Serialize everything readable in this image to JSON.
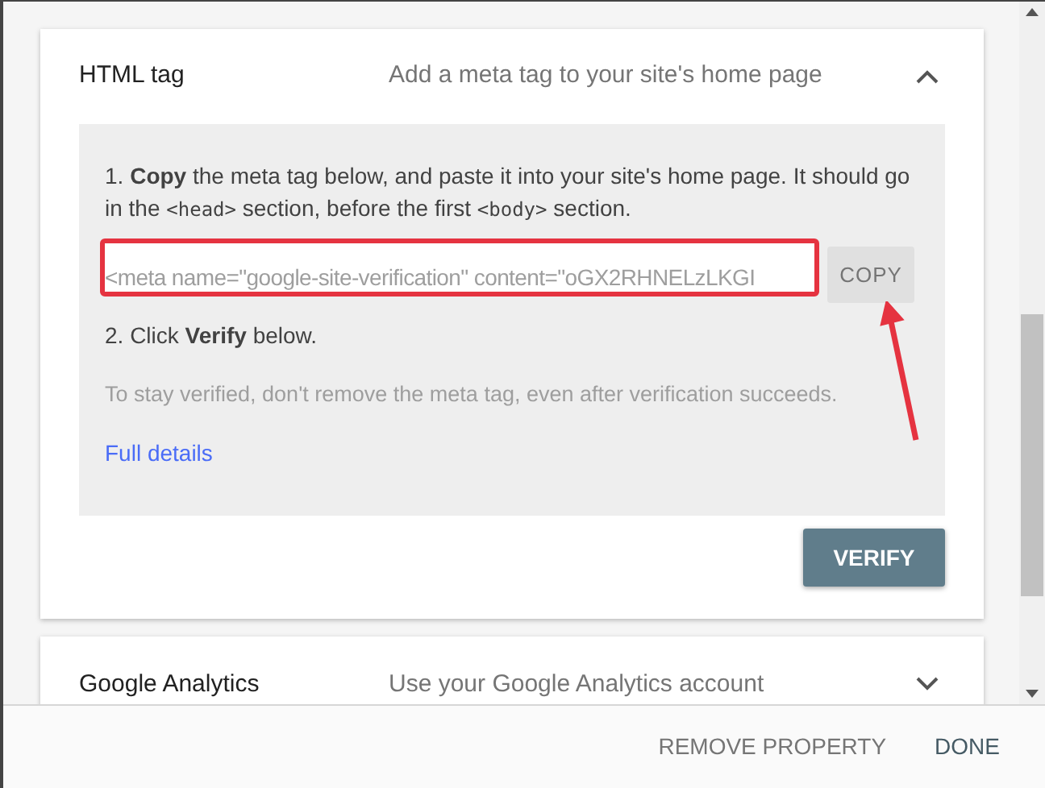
{
  "methods": [
    {
      "title": "HTML tag",
      "description": "Add a meta tag to your site's home page",
      "expanded": true,
      "step1": [
        {
          "kind": "text",
          "text": "1. "
        },
        {
          "kind": "bold",
          "text": "Copy"
        },
        {
          "kind": "text",
          "text": " the meta tag below, and paste it into your site's home page. It should go in the "
        },
        {
          "kind": "code",
          "text": "<head>"
        },
        {
          "kind": "text",
          "text": " section, before the first "
        },
        {
          "kind": "code",
          "text": "<body>"
        },
        {
          "kind": "text",
          "text": " section."
        }
      ],
      "meta_tag": "<meta name=\"google-site-verification\" content=\"oGX2RHNELzLKGI",
      "copy_button": "COPY",
      "step2": "2. Click **Verify** below.",
      "note": "To stay verified, don't remove the meta tag, even after verification succeeds.",
      "link": "Full details",
      "verify_button": "VERIFY"
    },
    {
      "title": "Google Analytics",
      "description": "Use your Google Analytics account",
      "expanded": false
    }
  ],
  "footer": {
    "buttons": [
      "REMOVE PROPERTY",
      "DONE"
    ]
  }
}
